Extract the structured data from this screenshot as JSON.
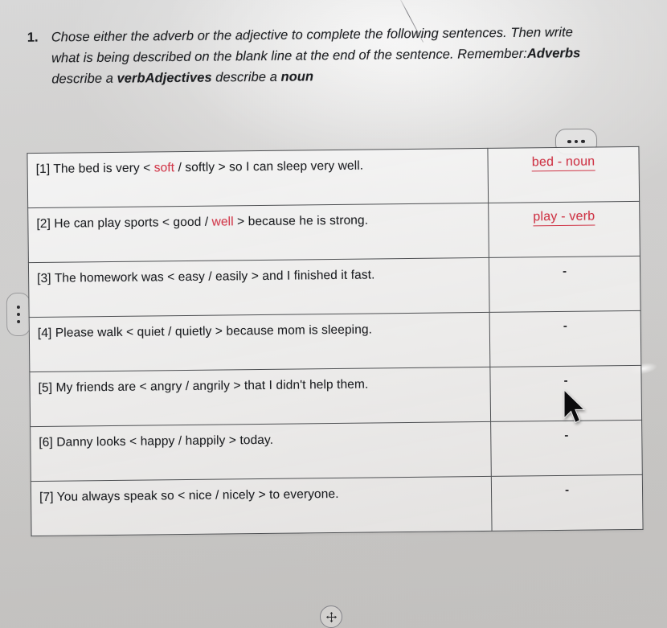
{
  "heading": {
    "number": "1.",
    "line1": "Chose either the adverb or the adjective to complete the following sentences. Then write",
    "line2_pre": "what is being described on the blank line at the end of the sentence. Remember:",
    "line2_bold": "Adverbs",
    "line3_pre": "describe a ",
    "line3_bold1": "verbAdjectives",
    "line3_mid": " describe a ",
    "line3_bold2": "noun"
  },
  "controls": {
    "more_label": "•••",
    "more_icon": "ellipsis-horizontal-icon",
    "left_handle_icon": "ellipsis-vertical-icon",
    "move_handle_icon": "move-arrows-icon",
    "cursor_icon": "mouse-pointer-icon"
  },
  "colors": {
    "answer_red": "#cf3446",
    "choice_red": "#d2394b",
    "ink": "#1b1d20",
    "border": "#4d4f52",
    "page_bg": "#d4d3d2"
  },
  "table": {
    "rows": [
      {
        "label": "[1]",
        "pre": " The bed is very < ",
        "choice_a": "soft",
        "sep": " / ",
        "choice_b": "softly",
        "post": " > so I can sleep very well.",
        "selected": "a",
        "answer": "bed - noun",
        "answer_blank": false
      },
      {
        "label": "[2]",
        "pre": " He can play sports < ",
        "choice_a": "good",
        "sep": " / ",
        "choice_b": "well",
        "post": " > because he is strong.",
        "selected": "b",
        "answer": "play - verb",
        "answer_blank": false
      },
      {
        "label": "[3]",
        "pre": " The homework was < ",
        "choice_a": "easy",
        "sep": " / ",
        "choice_b": "easily",
        "post": " > and I finished it fast.",
        "selected": "none",
        "answer": "-",
        "answer_blank": true
      },
      {
        "label": "[4]",
        "pre": " Please walk < ",
        "choice_a": "quiet",
        "sep": " / ",
        "choice_b": "quietly",
        "post": " > because mom is sleeping.",
        "selected": "none",
        "answer": "-",
        "answer_blank": true
      },
      {
        "label": "[5]",
        "pre": " My friends are < ",
        "choice_a": "angry",
        "sep": " / ",
        "choice_b": "angrily",
        "post": " > that I didn't help them.",
        "selected": "none",
        "answer": "-",
        "answer_blank": true
      },
      {
        "label": "[6]",
        "pre": " Danny looks < ",
        "choice_a": "happy",
        "sep": " / ",
        "choice_b": "happily",
        "post": " > today.",
        "selected": "none",
        "answer": "-",
        "answer_blank": true
      },
      {
        "label": "[7]",
        "pre": " You always speak so < ",
        "choice_a": "nice",
        "sep": " / ",
        "choice_b": "nicely",
        "post": " > to everyone.",
        "selected": "none",
        "answer": "-",
        "answer_blank": true
      }
    ]
  }
}
